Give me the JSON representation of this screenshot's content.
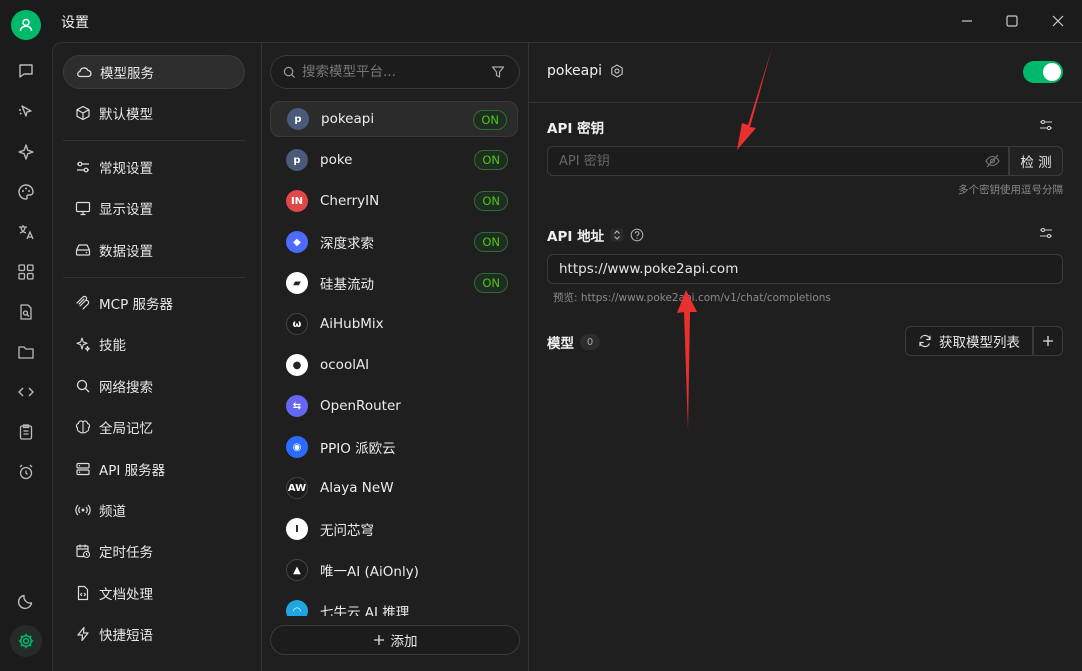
{
  "window": {
    "title": "设置"
  },
  "settings_menu": {
    "items": [
      {
        "label": "模型服务",
        "icon": "cloud-icon",
        "active": true
      },
      {
        "label": "默认模型",
        "icon": "cube-icon"
      },
      {
        "label": "常规设置",
        "icon": "sliders-icon"
      },
      {
        "label": "显示设置",
        "icon": "monitor-icon"
      },
      {
        "label": "数据设置",
        "icon": "hard-drive-icon"
      },
      {
        "label": "MCP 服务器",
        "icon": "mcp-icon"
      },
      {
        "label": "技能",
        "icon": "sparkles-icon"
      },
      {
        "label": "网络搜索",
        "icon": "search-icon"
      },
      {
        "label": "全局记忆",
        "icon": "brain-icon"
      },
      {
        "label": "API 服务器",
        "icon": "server-icon"
      },
      {
        "label": "频道",
        "icon": "radio-icon"
      },
      {
        "label": "定时任务",
        "icon": "calendar-clock-icon"
      },
      {
        "label": "文档处理",
        "icon": "file-code-icon"
      },
      {
        "label": "快捷短语",
        "icon": "zap-icon"
      }
    ]
  },
  "providers": {
    "search_placeholder": "搜索模型平台...",
    "on_label": "ON",
    "items": [
      {
        "name": "pokeapi",
        "logo_text": "p",
        "logo_color": "#4a5a78",
        "on": true,
        "active": true
      },
      {
        "name": "poke",
        "logo_text": "p",
        "logo_color": "#4a5a78",
        "on": true
      },
      {
        "name": "CherryIN",
        "logo_text": "IN",
        "logo_color": "#e04848",
        "on": true
      },
      {
        "name": "深度求索",
        "logo_text": "◆",
        "logo_color": "#4d6bfe",
        "on": true
      },
      {
        "name": "硅基流动",
        "logo_text": "▰",
        "logo_color": "#ffffff",
        "on": true
      },
      {
        "name": "AiHubMix",
        "logo_text": "ω",
        "logo_color": "#1c1c1c"
      },
      {
        "name": "ocoolAI",
        "logo_text": "●",
        "logo_color": "#ffffff"
      },
      {
        "name": "OpenRouter",
        "logo_text": "⇆",
        "logo_color": "#6467f2"
      },
      {
        "name": "PPIO 派欧云",
        "logo_text": "◉",
        "logo_color": "#2b6bff"
      },
      {
        "name": "Alaya NeW",
        "logo_text": "AW",
        "logo_color": "#1c1c1c"
      },
      {
        "name": "无问芯穹",
        "logo_text": "I",
        "logo_color": "#ffffff"
      },
      {
        "name": "唯一AI (AiOnly)",
        "logo_text": "▲",
        "logo_color": "#1c1c1c"
      },
      {
        "name": "七牛云 AI 推理",
        "logo_text": "◠",
        "logo_color": "#1fa6e0"
      }
    ],
    "add_label": "添加"
  },
  "detail": {
    "provider_name": "pokeapi",
    "enabled": true,
    "api_key": {
      "label": "API 密钥",
      "placeholder": "API 密钥",
      "check_label": "检 测",
      "hint": "多个密钥使用逗号分隔"
    },
    "api_url": {
      "label": "API 地址",
      "value": "https://www.poke2api.com",
      "preview": "预览: https://www.poke2api.com/v1/chat/completions"
    },
    "models": {
      "label": "模型",
      "count": "0",
      "fetch_label": "获取模型列表"
    }
  },
  "colors": {
    "accent": "#00b96b",
    "on_text": "#52c41a",
    "arrow": "#e8302f"
  }
}
